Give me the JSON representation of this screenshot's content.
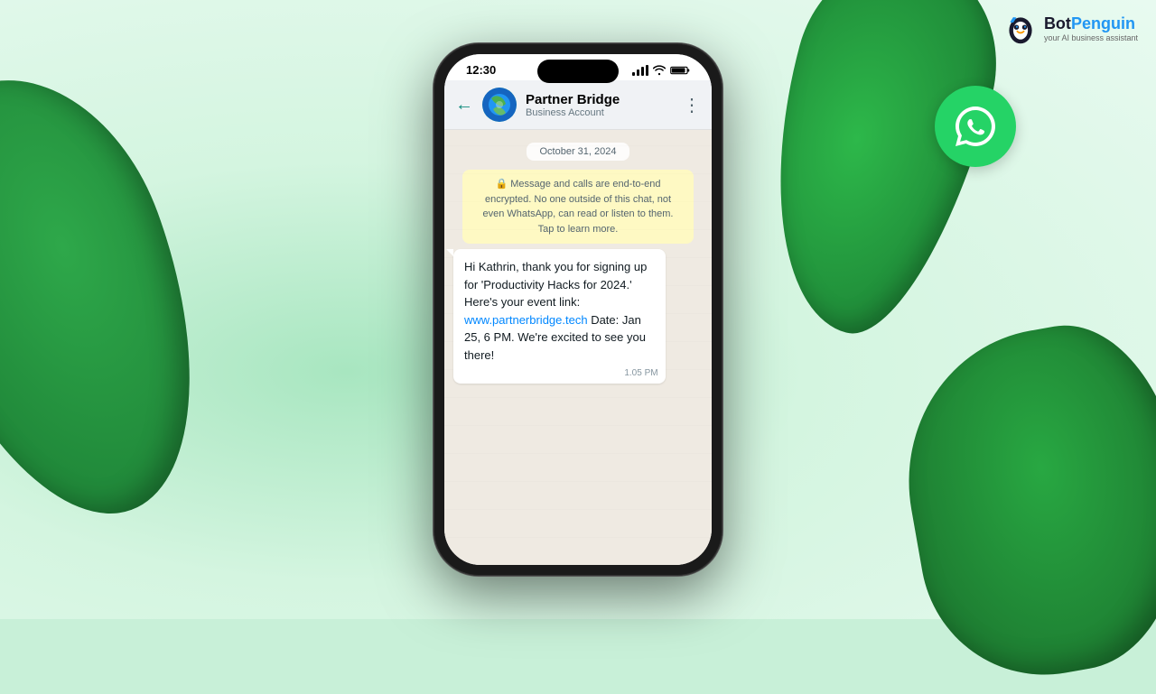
{
  "background": {
    "color": "#c8f0d8"
  },
  "logo": {
    "bot_text": "Bot",
    "penguin_text": "Penguin",
    "tagline": "your AI business assistant"
  },
  "phone": {
    "status_bar": {
      "time": "12:30"
    },
    "header": {
      "contact_name": "Partner Bridge",
      "contact_status": "Business Account",
      "menu_icon": "⋮"
    },
    "chat": {
      "date_badge": "October 31, 2024",
      "encryption_text": "🔒 Message and calls are end-to-end encrypted. No one outside of this chat, not even WhatsApp, can read or listen to them. Tap to learn more.",
      "message_body": "Hi Kathrin, thank you for signing up for 'Productivity Hacks for 2024.' Here's your event link: ",
      "message_link_text": "www.partnerbridge.tech",
      "message_link_url": "http://www.partnerbridge.tech",
      "message_footer": "\n\nDate: Jan 25, 6 PM. We're excited to see you there!",
      "message_time": "1.05 PM"
    }
  }
}
